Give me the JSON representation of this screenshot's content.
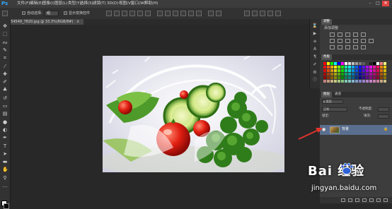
{
  "app": {
    "logo": "Ps"
  },
  "menubar": {
    "items": [
      "文件(F)",
      "编辑(E)",
      "图像(I)",
      "图层(L)",
      "类型(Y)",
      "选择(S)",
      "滤镜(T)",
      "3D(D)",
      "视图(V)",
      "窗口(W)",
      "帮助(H)"
    ],
    "window_controls": [
      "–",
      "□",
      "✕"
    ]
  },
  "options_bar": {
    "auto_select_label": "自动选择:",
    "auto_select_value": "组",
    "show_transform_label": "显示变换控件"
  },
  "document": {
    "tab_title": "154549_7820.jpg @ 33.3%(RGB/8#)",
    "close_glyph": "×"
  },
  "panels": {
    "adjustments": {
      "tab": "调整",
      "title": "添加调整"
    },
    "swatches": {
      "tab": "色板"
    },
    "layers": {
      "tabs": [
        "图层",
        "通道"
      ],
      "filter_label": "ρ 类型",
      "blend_mode": "正常",
      "opacity_label": "不透明度:",
      "lock_label": "锁定:",
      "fill_label": "填充:",
      "layer_name": "背景"
    }
  },
  "watermark": {
    "logo_text": "Bai 经验",
    "url": "jingyan.baidu.com"
  },
  "colors": {
    "accent": "#31a8ff",
    "selected_layer": "#5a6f8f",
    "arrow": "#e0342c"
  }
}
